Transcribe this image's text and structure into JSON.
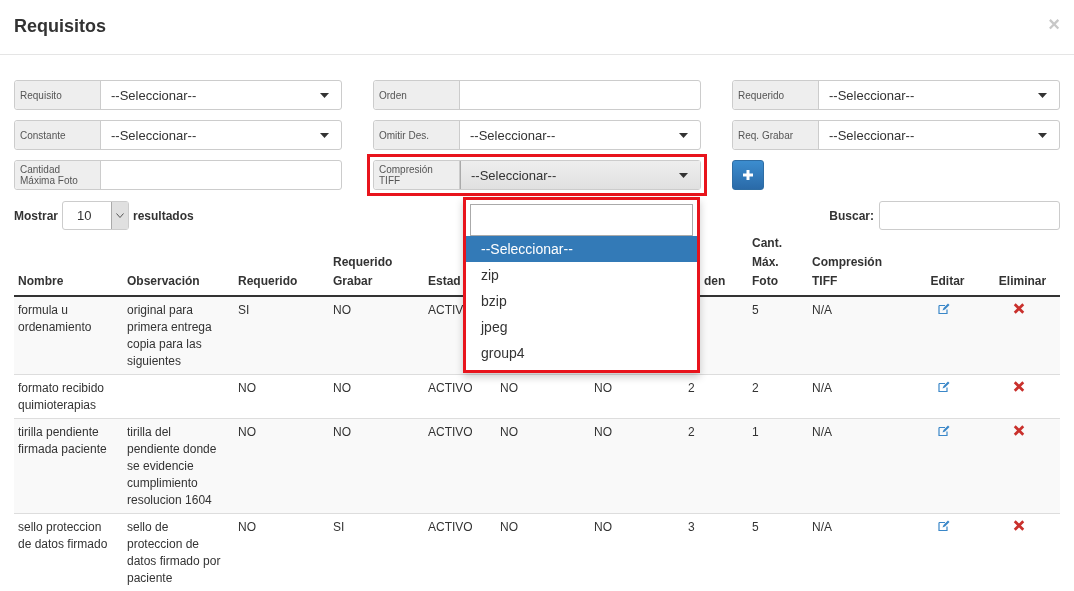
{
  "modal": {
    "title": "Requisitos",
    "close": "×"
  },
  "filters": [
    {
      "kind": "select",
      "label": "Requisito",
      "value": "--Seleccionar--",
      "active": false
    },
    {
      "kind": "input",
      "label": "Orden"
    },
    {
      "kind": "select",
      "label": "Requerido",
      "value": "--Seleccionar--",
      "active": false
    },
    {
      "kind": "select",
      "label": "Constante",
      "value": "--Seleccionar--",
      "active": false
    },
    {
      "kind": "select",
      "label": "Omitir Des.",
      "value": "--Seleccionar--",
      "active": false
    },
    {
      "kind": "select",
      "label": "Req. Grabar",
      "value": "--Seleccionar--",
      "active": false
    },
    {
      "kind": "input",
      "label": "Cantidad Máxima Foto"
    },
    {
      "kind": "select",
      "label": "Compresión TIFF",
      "value": "--Seleccionar--",
      "highlighted": true,
      "active": true
    },
    {
      "kind": "add_button"
    }
  ],
  "length_menu": {
    "prefix": "Mostrar",
    "value": "10",
    "suffix": "resultados"
  },
  "search": {
    "label": "Buscar:"
  },
  "dropdown": {
    "highlighted": true,
    "options": [
      {
        "label": "--Seleccionar--",
        "selected": true
      },
      {
        "label": "zip",
        "selected": false
      },
      {
        "label": "bzip",
        "selected": false
      },
      {
        "label": "jpeg",
        "selected": false
      },
      {
        "label": "group4",
        "selected": false
      }
    ]
  },
  "table": {
    "columns": [
      "Nombre",
      "Observación",
      "Requerido",
      "Requerido Grabar",
      "Estad",
      null,
      null,
      "den",
      "Cant. Máx. Foto",
      "Compresión TIFF",
      "Editar",
      "Eliminar"
    ],
    "rows": [
      {
        "cells": [
          "formula u ordenamiento",
          "original para primera entrega copia para las siguientes",
          "SI",
          "NO",
          "ACTIV",
          null,
          null,
          null,
          "5",
          "N/A"
        ]
      },
      {
        "cells": [
          "formato recibido quimioterapias",
          null,
          "NO",
          "NO",
          "ACTIVO",
          "NO",
          "NO",
          "2",
          "2",
          "N/A"
        ]
      },
      {
        "cells": [
          "tirilla pendiente firmada paciente",
          "tirilla del pendiente donde se evidencie cumplimiento resolucion 1604",
          "NO",
          "NO",
          "ACTIVO",
          "NO",
          "NO",
          "2",
          "1",
          "N/A"
        ]
      },
      {
        "cells": [
          "sello proteccion de datos firmado",
          "sello de proteccion de datos firmado por paciente",
          "NO",
          "SI",
          "ACTIVO",
          "NO",
          "NO",
          "3",
          "5",
          "N/A"
        ]
      }
    ]
  }
}
